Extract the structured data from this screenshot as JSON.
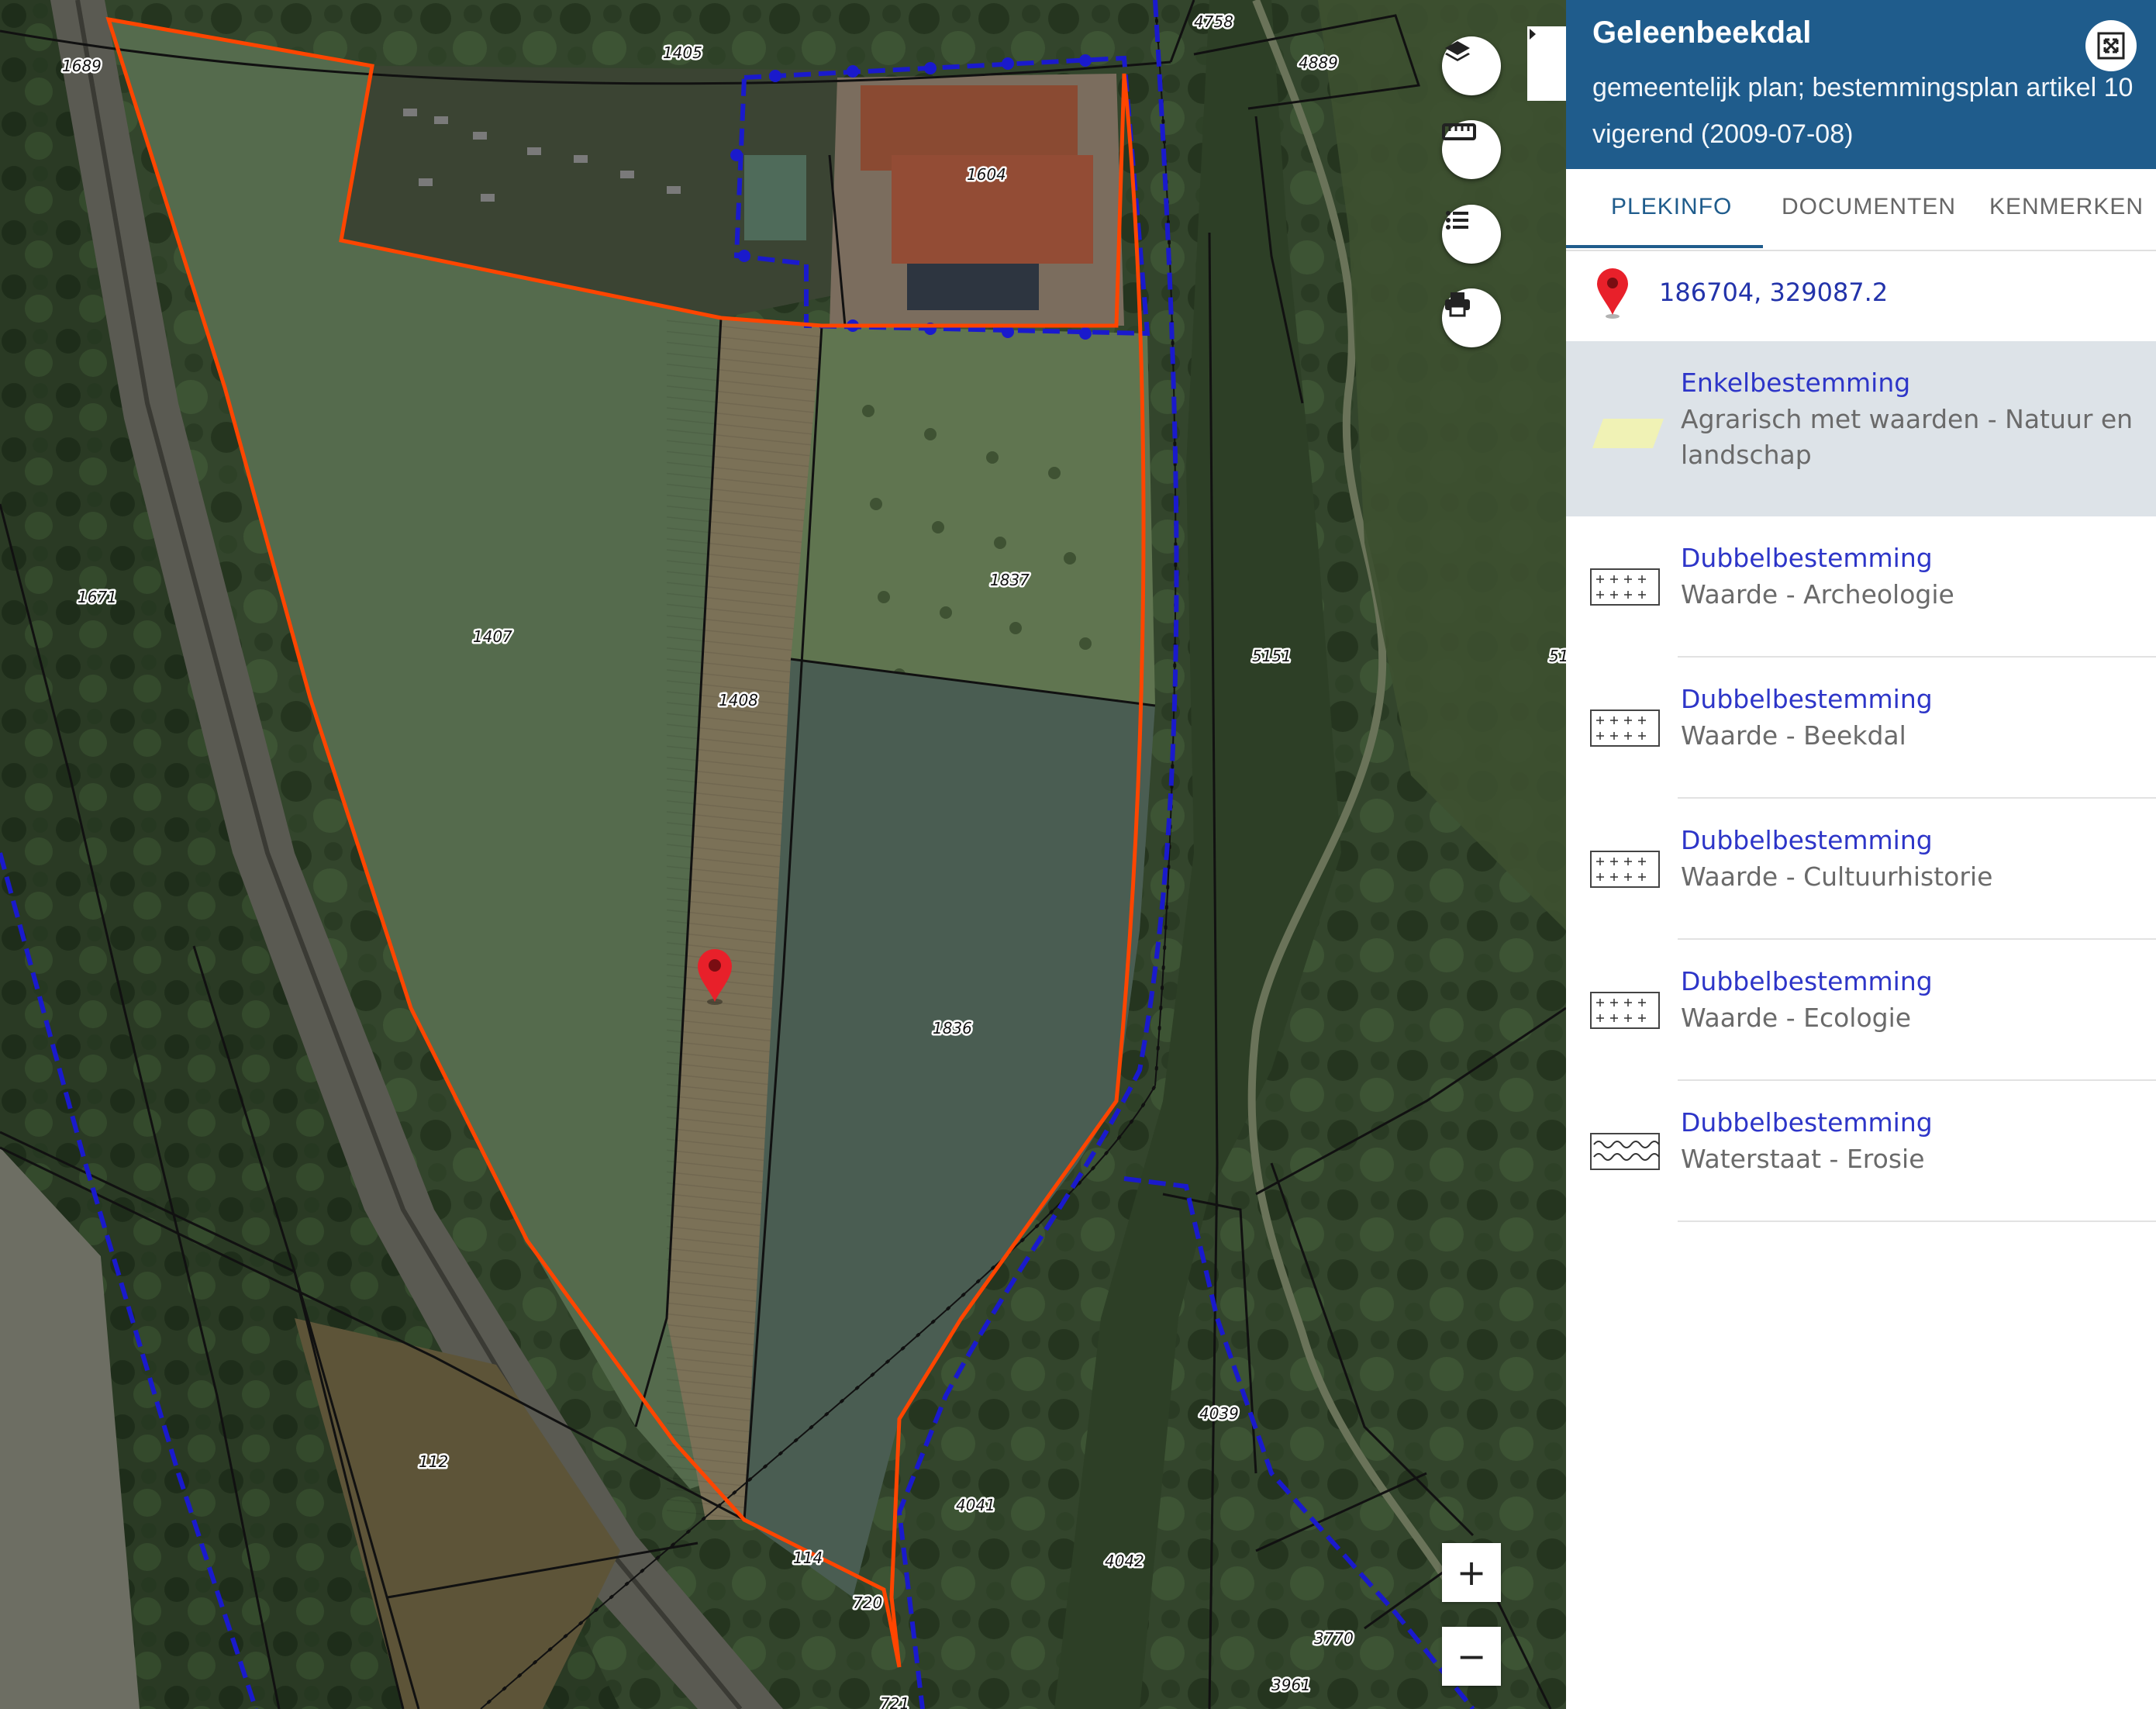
{
  "map": {
    "parcels": [
      "1405",
      "4758",
      "4889",
      "1689",
      "1604",
      "1837",
      "1671",
      "1407",
      "1408",
      "5151",
      "51",
      "1836",
      "112",
      "4039",
      "4041",
      "4042",
      "114",
      "720",
      "3770",
      "3961",
      "721"
    ],
    "marker_icon": "map-pin-icon",
    "controls": {
      "layers_icon": "layers-icon",
      "measure_icon": "ruler-icon",
      "legend_icon": "list-icon",
      "print_icon": "printer-icon",
      "collapse_icon": "chevron-right-icon",
      "zoom_in": "+",
      "zoom_out": "−"
    }
  },
  "panel": {
    "title": "Geleenbeekdal",
    "subtitle_line1": "gemeentelijk plan; bestemmingsplan artikel 10",
    "subtitle_line2": "vigerend (2009-07-08)",
    "fullscreen_icon": "fullscreen-icon",
    "tabs": [
      {
        "label": "PLEKINFO",
        "active": true
      },
      {
        "label": "DOCUMENTEN",
        "active": false
      },
      {
        "label": "KENMERKEN",
        "active": false
      }
    ],
    "coordinates": "186704, 329087.2",
    "items": [
      {
        "type": "Enkelbestemming",
        "name": "Agrarisch met waarden - Natuur en landschap",
        "icon": "yellow-fill-swatch-icon",
        "selected": true
      },
      {
        "type": "Dubbelbestemming",
        "name": "Waarde - Archeologie",
        "icon": "crosses-pattern-icon",
        "selected": false
      },
      {
        "type": "Dubbelbestemming",
        "name": "Waarde - Beekdal",
        "icon": "crosses-pattern-icon",
        "selected": false
      },
      {
        "type": "Dubbelbestemming",
        "name": "Waarde - Cultuurhistorie",
        "icon": "crosses-pattern-icon",
        "selected": false
      },
      {
        "type": "Dubbelbestemming",
        "name": "Waarde - Ecologie",
        "icon": "crosses-pattern-icon",
        "selected": false
      },
      {
        "type": "Dubbelbestemming",
        "name": "Waterstaat - Erosie",
        "icon": "wave-pattern-icon",
        "selected": false
      }
    ]
  },
  "colors": {
    "header_bg": "#1f5c8c",
    "plan_outline": "#ff4500",
    "boundary_dashed": "#1a1acc",
    "link_text": "#2d35c8",
    "marker": "#e8202a"
  }
}
